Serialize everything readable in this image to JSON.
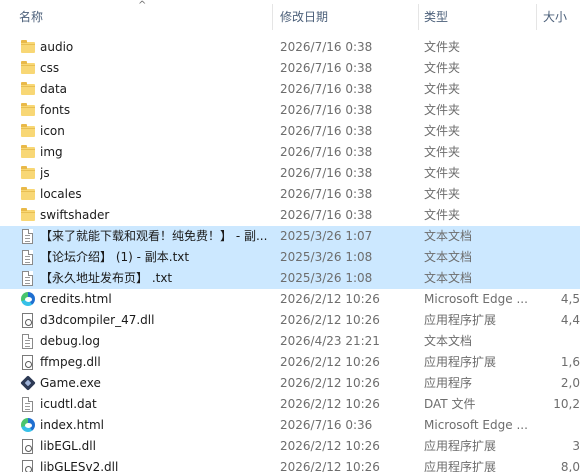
{
  "columns": {
    "name": "名称",
    "modified": "修改日期",
    "type": "类型",
    "size": "大小"
  },
  "rows": [
    {
      "icon": "folder-icon",
      "name": "audio",
      "date": "2026/7/16 0:38",
      "type": "文件夹",
      "size": "",
      "selected": false
    },
    {
      "icon": "folder-icon",
      "name": "css",
      "date": "2026/7/16 0:38",
      "type": "文件夹",
      "size": "",
      "selected": false
    },
    {
      "icon": "folder-icon",
      "name": "data",
      "date": "2026/7/16 0:38",
      "type": "文件夹",
      "size": "",
      "selected": false
    },
    {
      "icon": "folder-icon",
      "name": "fonts",
      "date": "2026/7/16 0:38",
      "type": "文件夹",
      "size": "",
      "selected": false
    },
    {
      "icon": "folder-icon",
      "name": "icon",
      "date": "2026/7/16 0:38",
      "type": "文件夹",
      "size": "",
      "selected": false
    },
    {
      "icon": "folder-icon",
      "name": "img",
      "date": "2026/7/16 0:38",
      "type": "文件夹",
      "size": "",
      "selected": false
    },
    {
      "icon": "folder-icon",
      "name": "js",
      "date": "2026/7/16 0:38",
      "type": "文件夹",
      "size": "",
      "selected": false
    },
    {
      "icon": "folder-icon",
      "name": "locales",
      "date": "2026/7/16 0:38",
      "type": "文件夹",
      "size": "",
      "selected": false
    },
    {
      "icon": "folder-icon",
      "name": "swiftshader",
      "date": "2026/7/16 0:38",
      "type": "文件夹",
      "size": "",
      "selected": false
    },
    {
      "icon": "text-file-icon",
      "name": "【来了就能下载和观看！纯免费！】 - 副...",
      "date": "2025/3/26 1:07",
      "type": "文本文档",
      "size": "",
      "selected": true
    },
    {
      "icon": "text-file-icon",
      "name": "【论坛介绍】 (1) - 副本.txt",
      "date": "2025/3/26 1:08",
      "type": "文本文档",
      "size": "",
      "selected": true
    },
    {
      "icon": "text-file-icon",
      "name": "【永久地址发布页】 .txt",
      "date": "2025/3/26 1:08",
      "type": "文本文档",
      "size": "",
      "selected": true
    },
    {
      "icon": "edge-icon",
      "name": "credits.html",
      "date": "2026/2/12 10:26",
      "type": "Microsoft Edge ...",
      "size": "4,5",
      "selected": false
    },
    {
      "icon": "dll-file-icon",
      "name": "d3dcompiler_47.dll",
      "date": "2026/2/12 10:26",
      "type": "应用程序扩展",
      "size": "4,4",
      "selected": false
    },
    {
      "icon": "text-file-icon",
      "name": "debug.log",
      "date": "2026/4/23 21:21",
      "type": "文本文档",
      "size": "",
      "selected": false
    },
    {
      "icon": "dll-file-icon",
      "name": "ffmpeg.dll",
      "date": "2026/2/12 10:26",
      "type": "应用程序扩展",
      "size": "1,6",
      "selected": false
    },
    {
      "icon": "game-exe-icon",
      "name": "Game.exe",
      "date": "2026/2/12 10:26",
      "type": "应用程序",
      "size": "2,0",
      "selected": false
    },
    {
      "icon": "text-file-icon",
      "name": "icudtl.dat",
      "date": "2026/2/12 10:26",
      "type": "DAT 文件",
      "size": "10,2",
      "selected": false
    },
    {
      "icon": "edge-icon",
      "name": "index.html",
      "date": "2026/7/16 0:36",
      "type": "Microsoft Edge ...",
      "size": "",
      "selected": false
    },
    {
      "icon": "dll-file-icon",
      "name": "libEGL.dll",
      "date": "2026/2/12 10:26",
      "type": "应用程序扩展",
      "size": "3",
      "selected": false
    },
    {
      "icon": "dll-file-icon",
      "name": "libGLESv2.dll",
      "date": "2026/2/12 10:26",
      "type": "应用程序扩展",
      "size": "8,0",
      "selected": false
    }
  ]
}
